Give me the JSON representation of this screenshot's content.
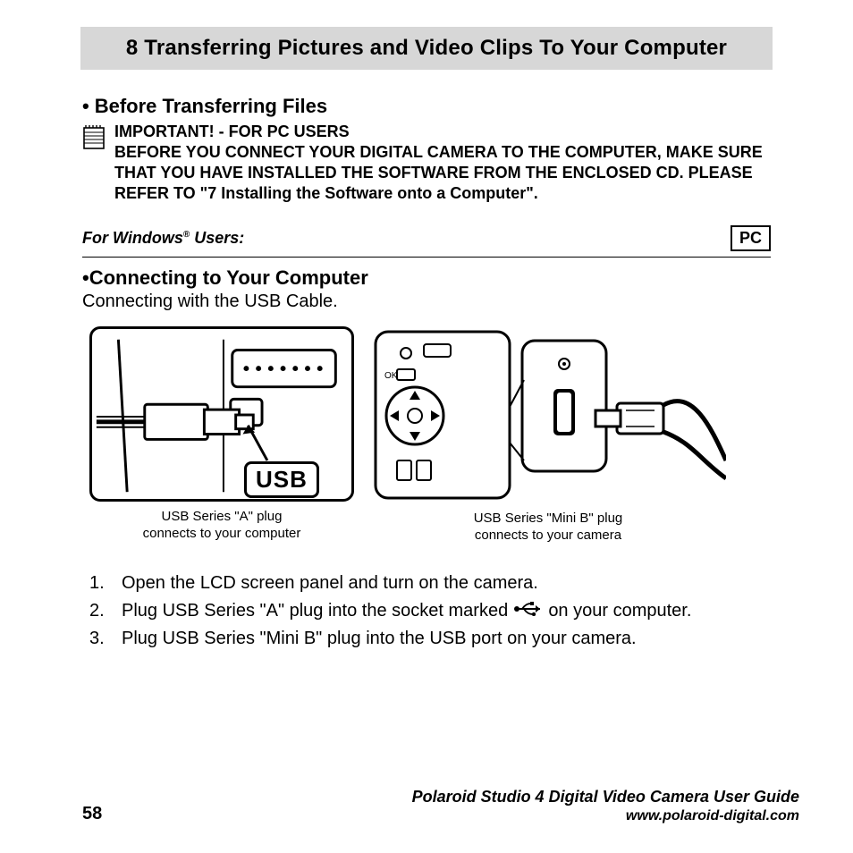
{
  "chapter": {
    "title": "8 Transferring Pictures and Video Clips To Your Computer"
  },
  "sections": {
    "before": {
      "heading": "Before Transferring Files",
      "important_label": "IMPORTANT! - FOR PC USERS",
      "important_body": "BEFORE YOU CONNECT YOUR DIGITAL CAMERA TO THE COMPUTER, MAKE SURE THAT YOU HAVE INSTALLED THE SOFTWARE FROM THE ENCLOSED CD. PLEASE REFER TO \"7 Installing the Software onto a Computer\"."
    },
    "windows": {
      "label_prefix": "For Windows",
      "label_suffix": " Users:",
      "badge": "PC"
    },
    "connect": {
      "heading": "Connecting to Your Computer",
      "subheading": "Connecting with the USB Cable."
    }
  },
  "figures": {
    "a": {
      "usb_badge": "USB",
      "caption_line1": "USB Series \"A\" plug",
      "caption_line2": "connects to your computer"
    },
    "b": {
      "caption_line1": "USB Series \"Mini B\" plug",
      "caption_line2": "connects to your camera"
    }
  },
  "steps": [
    "Open the LCD screen panel and turn on the camera.",
    "Plug USB Series \"A\" plug into the socket marked",
    "on your computer.",
    "Plug USB Series \"Mini B\" plug into the USB port on your camera."
  ],
  "step_numbers": [
    "1.",
    "2.",
    "3."
  ],
  "footer": {
    "page": "58",
    "guide_title": "Polaroid Studio 4 Digital Video Camera User Guide",
    "url": "www.polaroid-digital.com"
  }
}
